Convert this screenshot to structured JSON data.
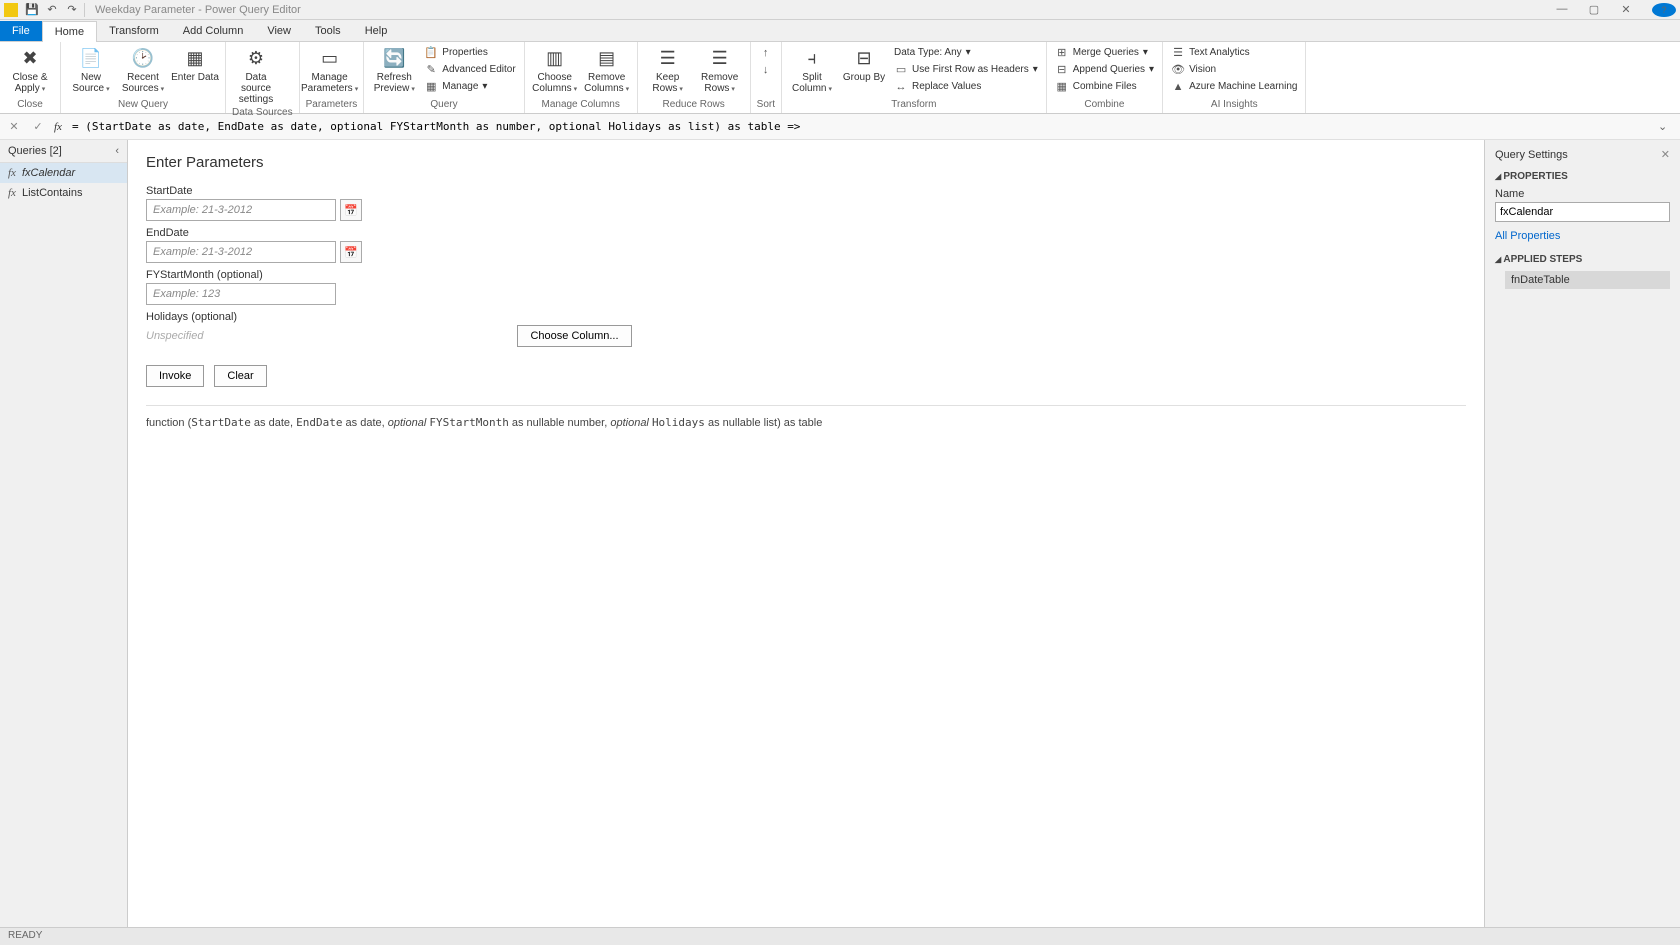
{
  "title": "Weekday Parameter - Power Query Editor",
  "tabs": {
    "file": "File",
    "home": "Home",
    "transform": "Transform",
    "addcolumn": "Add Column",
    "view": "View",
    "tools": "Tools",
    "help": "Help"
  },
  "ribbon": {
    "close_apply": "Close &\nApply",
    "new_source": "New\nSource",
    "recent_sources": "Recent\nSources",
    "enter_data": "Enter\nData",
    "data_source_settings": "Data source\nsettings",
    "manage_parameters": "Manage\nParameters",
    "refresh_preview": "Refresh\nPreview",
    "properties": "Properties",
    "advanced_editor": "Advanced Editor",
    "manage": "Manage",
    "choose_columns": "Choose\nColumns",
    "remove_columns": "Remove\nColumns",
    "keep_rows": "Keep\nRows",
    "remove_rows": "Remove\nRows",
    "sort": "Sort",
    "split_column": "Split\nColumn",
    "group_by": "Group\nBy",
    "data_type": "Data Type: Any",
    "use_first_row": "Use First Row as Headers",
    "replace_values": "Replace Values",
    "merge_queries": "Merge Queries",
    "append_queries": "Append Queries",
    "combine_files": "Combine Files",
    "text_analytics": "Text Analytics",
    "vision": "Vision",
    "azure_ml": "Azure Machine Learning",
    "groups": {
      "close": "Close",
      "new_query": "New Query",
      "data_sources": "Data Sources",
      "parameters": "Parameters",
      "query": "Query",
      "manage_columns": "Manage Columns",
      "reduce_rows": "Reduce Rows",
      "sort_g": "Sort",
      "transform": "Transform",
      "combine": "Combine",
      "ai_insights": "AI Insights"
    }
  },
  "formula": "= (StartDate as date, EndDate as date, optional FYStartMonth as number, optional Holidays as list) as table =>",
  "queries": {
    "header": "Queries [2]",
    "items": [
      "fxCalendar",
      "ListContains"
    ]
  },
  "params": {
    "title": "Enter Parameters",
    "startdate_label": "StartDate",
    "startdate_ph": "Example: 21-3-2012",
    "enddate_label": "EndDate",
    "enddate_ph": "Example: 21-3-2012",
    "fystart_label": "FYStartMonth (optional)",
    "fystart_ph": "Example: 123",
    "holidays_label": "Holidays (optional)",
    "unspecified": "Unspecified",
    "choose_column": "Choose Column...",
    "invoke": "Invoke",
    "clear": "Clear"
  },
  "signature": {
    "prefix": "function (",
    "p1": "StartDate",
    "p1t": " as date, ",
    "p2": "EndDate",
    "p2t": " as date, ",
    "opt1": "optional ",
    "p3": "FYStartMonth",
    "p3t": " as nullable number, ",
    "opt2": "optional ",
    "p4": "Holidays",
    "p4t": " as nullable list) as table"
  },
  "settings": {
    "header": "Query Settings",
    "properties": "PROPERTIES",
    "name_label": "Name",
    "name_value": "fxCalendar",
    "all_properties": "All Properties",
    "applied_steps": "APPLIED STEPS",
    "step1": "fnDateTable"
  },
  "status": "READY"
}
